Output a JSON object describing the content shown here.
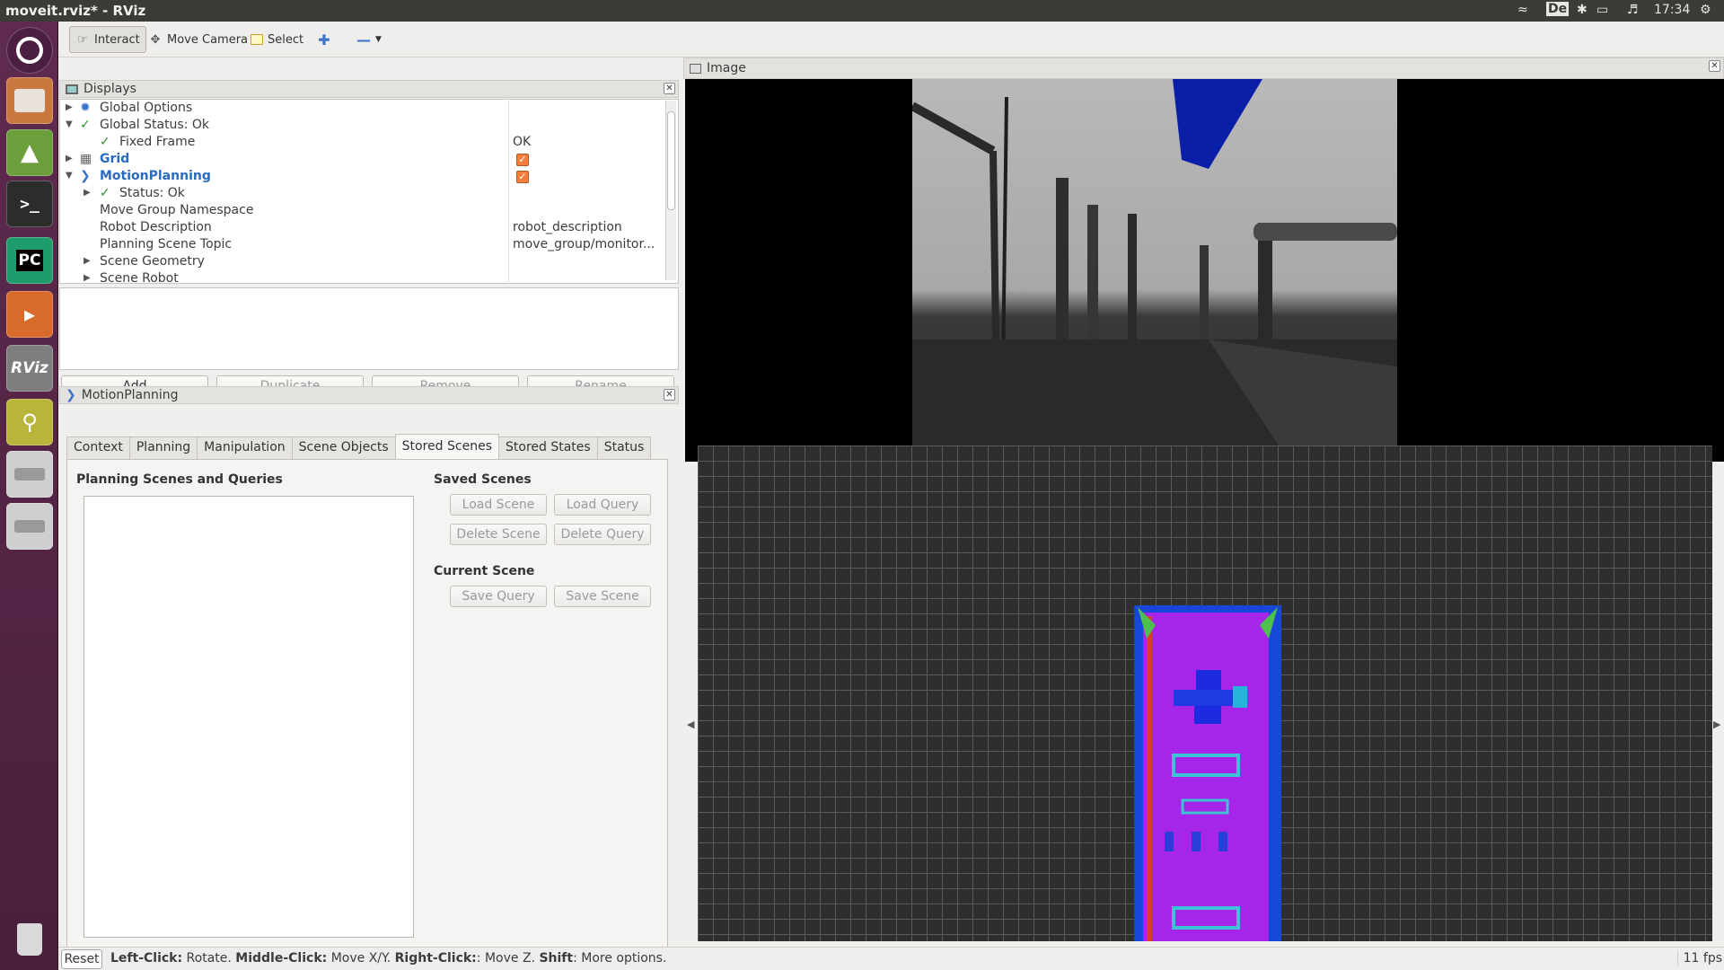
{
  "window": {
    "title": "moveit.rviz* - RViz",
    "clock": "17:34",
    "keyboard": "De"
  },
  "toolbar": {
    "interact": "Interact",
    "move_camera": "Move Camera",
    "select": "Select"
  },
  "displays_panel": {
    "title": "Displays",
    "rows": [
      {
        "label": "Global Options",
        "value": ""
      },
      {
        "label": "Global Status: Ok",
        "value": ""
      },
      {
        "label": "Fixed Frame",
        "value": "OK"
      },
      {
        "label": "Grid",
        "value": ""
      },
      {
        "label": "MotionPlanning",
        "value": ""
      },
      {
        "label": "Status: Ok",
        "value": ""
      },
      {
        "label": "Move Group Namespace",
        "value": ""
      },
      {
        "label": "Robot Description",
        "value": "robot_description"
      },
      {
        "label": "Planning Scene Topic",
        "value": "move_group/monitor..."
      },
      {
        "label": "Scene Geometry",
        "value": ""
      },
      {
        "label": "Scene Robot",
        "value": ""
      }
    ],
    "buttons": {
      "add": "Add",
      "duplicate": "Duplicate",
      "remove": "Remove",
      "rename": "Rename"
    }
  },
  "motion_planning": {
    "title": "MotionPlanning",
    "tabs": [
      "Context",
      "Planning",
      "Manipulation",
      "Scene Objects",
      "Stored Scenes",
      "Stored States",
      "Status"
    ],
    "selected_tab": "Stored Scenes",
    "list_title": "Planning Scenes and Queries",
    "saved_scenes_title": "Saved Scenes",
    "load_scene": "Load Scene",
    "load_query": "Load Query",
    "delete_scene": "Delete Scene",
    "delete_query": "Delete Query",
    "current_scene_title": "Current Scene",
    "save_query": "Save Query",
    "save_scene": "Save Scene"
  },
  "image_panel": {
    "title": "Image"
  },
  "statusbar": {
    "reset": "Reset",
    "hint_left_key": "Left-Click:",
    "hint_left": " Rotate. ",
    "hint_middle_key": "Middle-Click:",
    "hint_middle": " Move X/Y. ",
    "hint_right_key": "Right-Click:",
    "hint_right": ": Move Z. ",
    "hint_shift_key": "Shift",
    "hint_shift": ": More options.",
    "fps": "11 fps"
  },
  "launcher": {
    "rviz_label": "RViz",
    "pycharm_label": "PC"
  },
  "colors": {
    "accent": "#2a6bbf",
    "launcher": "#5f2a4e",
    "checkbox": "#f47e3c"
  }
}
